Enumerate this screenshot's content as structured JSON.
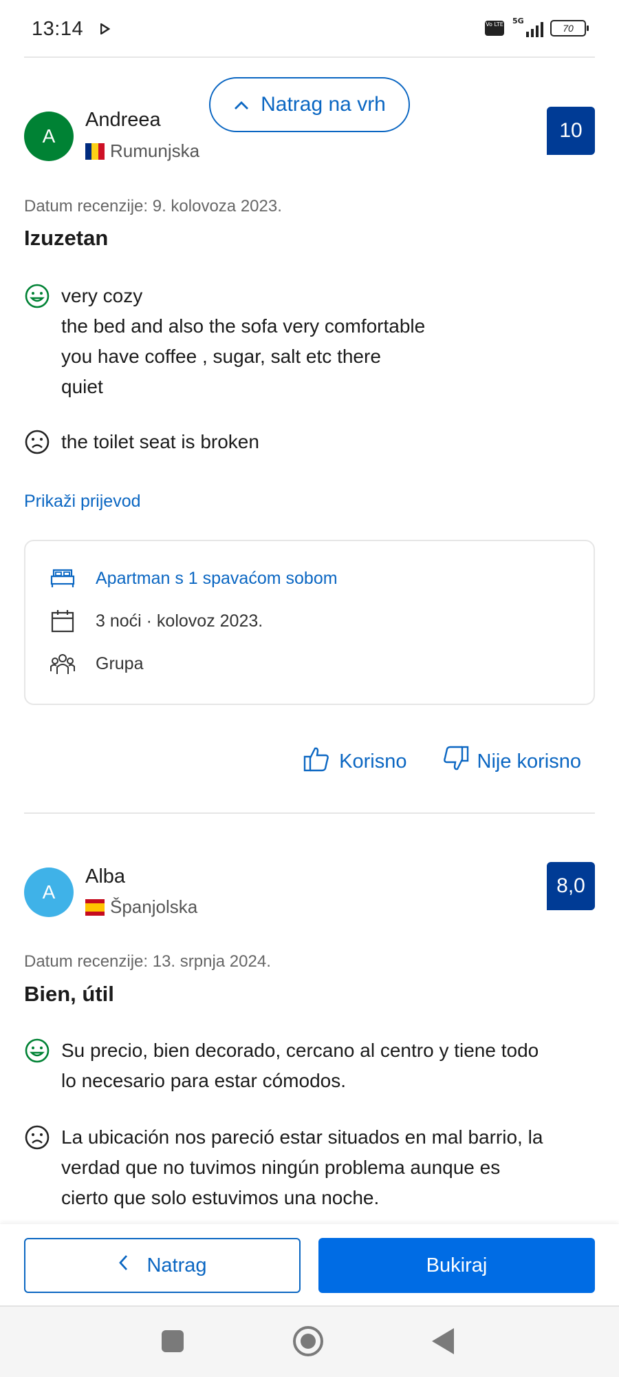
{
  "status_bar": {
    "time": "13:14",
    "volte_label": "Vo LTE",
    "network": "5G",
    "battery": "70"
  },
  "back_to_top": {
    "label": "Natrag na vrh"
  },
  "reviews": [
    {
      "avatar_letter": "A",
      "avatar_color": "#008234",
      "name": "Andreea",
      "country": "Rumunjska",
      "score": "10",
      "date": "Datum recenzije: 9. kolovoza 2023.",
      "title": "Izuzetan",
      "positive": "very cozy\nthe bed and also the sofa very comfortable\nyou have coffee , sugar, salt etc there\nquiet",
      "negative": "the toilet seat is broken",
      "translate_link": "Prikaži prijevod",
      "stay": {
        "room": "Apartman s 1 spavaćom sobom",
        "nights": "3 noći · kolovoz 2023.",
        "traveler_type": "Grupa"
      },
      "helpful_label": "Korisno",
      "not_helpful_label": "Nije korisno"
    },
    {
      "avatar_letter": "A",
      "avatar_color": "#3fb2e8",
      "name": "Alba",
      "country": "Španjolska",
      "score": "8,0",
      "date": "Datum recenzije: 13. srpnja 2024.",
      "title": "Bien, útil",
      "positive": "Su precio, bien decorado, cercano al centro y tiene todo\nlo necesario para estar cómodos.",
      "negative": "La ubicación nos pareció estar situados en mal barrio, la\nverdad que no tuvimos ningún problema aunque es\ncierto que solo estuvimos una noche."
    }
  ],
  "action_bar": {
    "back_label": "Natrag",
    "book_label": "Bukiraj"
  },
  "colors": {
    "accent": "#0a66c2",
    "score_bg": "#003b95",
    "book_bg": "#006ce4",
    "positive_icon": "#008234"
  }
}
